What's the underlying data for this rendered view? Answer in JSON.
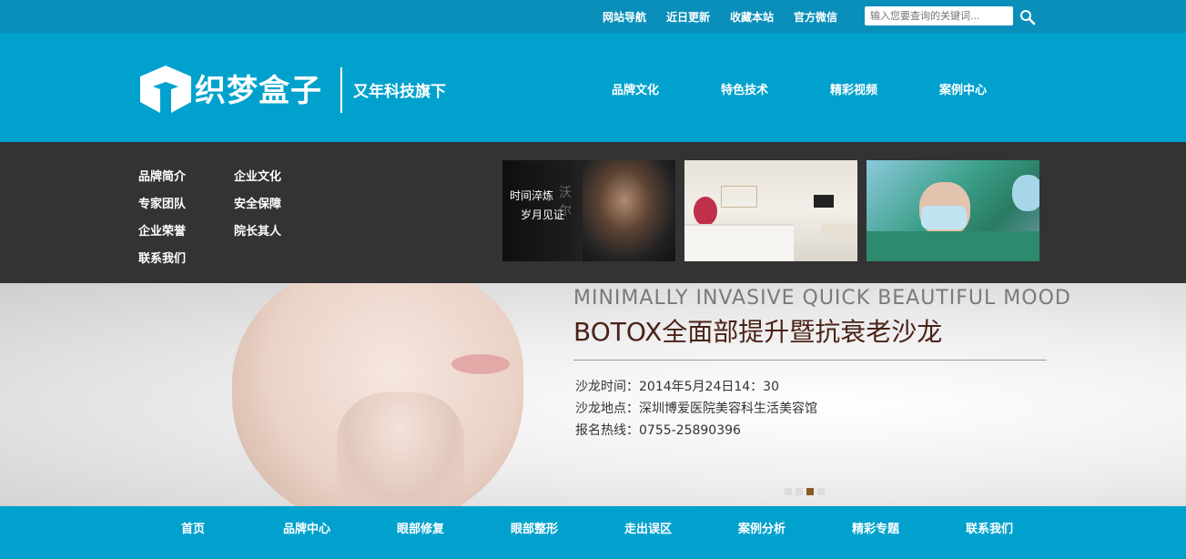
{
  "topbar": {
    "links": [
      "网站导航",
      "近日更新",
      "收藏本站",
      "官方微信"
    ],
    "search_placeholder": "输入您要查询的关键词...",
    "search_icon": "search-icon"
  },
  "header": {
    "logo_text": "织梦盒子",
    "slogan": "又年科技旗下",
    "nav": [
      "品牌文化",
      "特色技术",
      "精彩视频",
      "案例中心"
    ]
  },
  "dropdown": {
    "sublinks": [
      "品牌简介",
      "企业文化",
      "专家团队",
      "安全保障",
      "企业荣誉",
      "院长其人",
      "联系我们"
    ],
    "thumb1_caption_1": "时间淬炼",
    "thumb1_caption_2": "岁月见证",
    "thumb1_brand": "沃 尔"
  },
  "banner": {
    "english": "MINIMALLY INVASIVE QUICK BEAUTIFUL MOOD",
    "title": "BOTOX全面部提升暨抗衰老沙龙",
    "time": "沙龙时间：2014年5月24日14：30",
    "location": "沙龙地点：深圳博爱医院美容科生活美容馆",
    "hotline": "报名热线：0755-25890396",
    "slide_count": 4,
    "active_slide": 3
  },
  "footernav": {
    "links": [
      "首页",
      "品牌中心",
      "眼部修复",
      "眼部整形",
      "走出误区",
      "案例分析",
      "精彩专题",
      "联系我们"
    ]
  },
  "colors": {
    "topbar": "#0a8fba",
    "header": "#00a2cd",
    "dropdown": "#333333",
    "title": "#4a2218"
  }
}
